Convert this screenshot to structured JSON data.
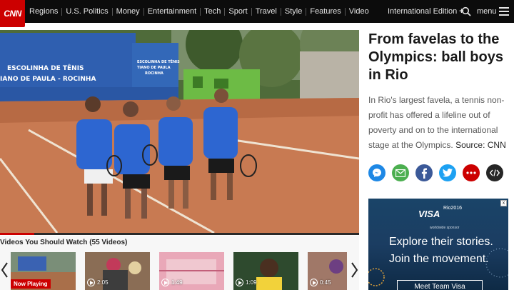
{
  "brand": {
    "logo_text": "CNN",
    "accent": "#cc0000"
  },
  "nav": {
    "items": [
      "Regions",
      "U.S. Politics",
      "Money",
      "Entertainment",
      "Tech",
      "Sport",
      "Travel",
      "Style",
      "Features",
      "Video"
    ],
    "edition_label": "International Edition",
    "edition_plus": "+",
    "menu_label": "menu"
  },
  "video": {
    "banner_line1": "ESCOLINHA DE TÊNIS",
    "banner_line2": "IANO DE PAULA - ROCINHA",
    "banner_line3": "ESCOLINHA DE TÊNIS",
    "banner_line4": "TIANO DE PAULA",
    "banner_line5": "ROCINHA",
    "progress": 0.095
  },
  "article": {
    "headline": "From favelas to the Olympics: ball boys in Rio",
    "description": "In Rio's largest favela, a tennis non-profit has offered a lifeline out of poverty and on to the international stage at the Olympics.",
    "source": "Source: CNN"
  },
  "share_buttons": [
    {
      "name": "messenger-icon",
      "color": "#1e88e5"
    },
    {
      "name": "email-icon",
      "color": "#4caf50"
    },
    {
      "name": "facebook-icon",
      "color": "#3b5998"
    },
    {
      "name": "twitter-icon",
      "color": "#1da1f2"
    },
    {
      "name": "more-icon",
      "color": "#cc0000"
    },
    {
      "name": "embed-icon",
      "color": "#262626"
    }
  ],
  "ad": {
    "brand": "VISA",
    "event": "Rio2016",
    "sponsor_line": "worldwide sponsor",
    "line1": "Explore their stories.",
    "line2": "Join the movement.",
    "cta": "Meet Team Visa",
    "close": "x"
  },
  "strip": {
    "title": "Videos You Should Watch (55 Videos)",
    "thumbs": [
      {
        "label": "Now Playing",
        "now_playing": true
      },
      {
        "duration": "2:05"
      },
      {
        "duration": "1:49"
      },
      {
        "duration": "1:09"
      },
      {
        "duration": "0:45"
      }
    ]
  }
}
